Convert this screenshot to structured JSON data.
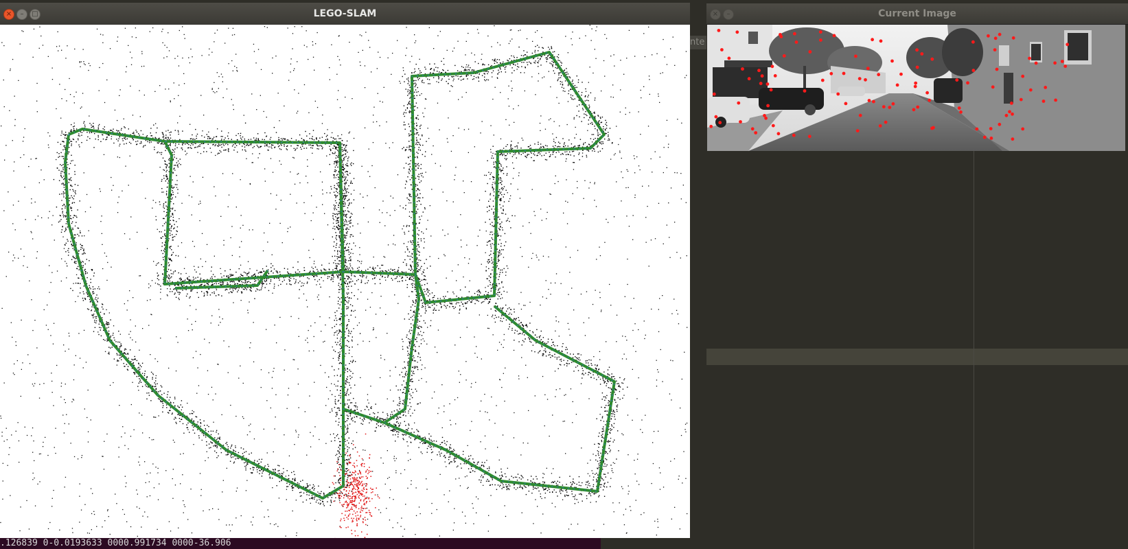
{
  "slam_window": {
    "title": "LEGO-SLAM",
    "buttons": {
      "close": "×",
      "minimize": "–",
      "maximize": "□"
    }
  },
  "image_window": {
    "title": "Current Image",
    "buttons": {
      "close": "×",
      "minimize": "–"
    }
  },
  "behind_window": {
    "label": "nte"
  },
  "terminal": {
    "output": ".126839 0-0.0193633 0000.991734 0000-36.906"
  },
  "colors": {
    "trajectory": "#2e8b2e",
    "trajectory_detail": "#2f6fc8",
    "map_points": "#000000",
    "local_points": "#e01010",
    "features": "#ff1a1a"
  }
}
